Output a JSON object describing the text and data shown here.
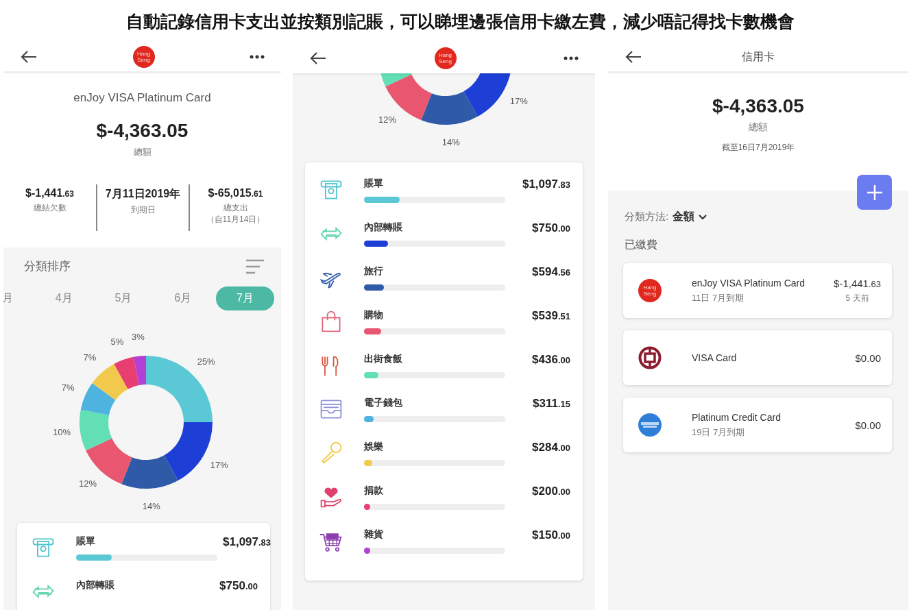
{
  "headline": "自動記錄信用卡支出並按類別記賬，可以睇埋邊張信用卡繳左費，減少唔記得找卡數機會",
  "card_detail": {
    "logo_text": "Hang Seng",
    "card_name": "enJoy VISA Platinum Card",
    "total": "$-4,363.05",
    "total_label": "總額",
    "summary": [
      {
        "amount": "$-1,441",
        "decimals": ".63",
        "label": "總結欠數"
      },
      {
        "amount": "7月11日2019年",
        "label": "到期日"
      },
      {
        "amount": "$-65,015",
        "decimals": ".61",
        "label": "總支出",
        "note": "（自11月14日）"
      }
    ],
    "sort_title": "分類排序",
    "months": [
      {
        "label": "月",
        "selected": false
      },
      {
        "label": "4月",
        "selected": false
      },
      {
        "label": "5月",
        "selected": false
      },
      {
        "label": "6月",
        "selected": false
      },
      {
        "label": "7月",
        "selected": true
      }
    ],
    "chart_data": {
      "type": "donut",
      "values": [
        25,
        17,
        14,
        12,
        10,
        7,
        7,
        5,
        3
      ],
      "colors": [
        "#5bc8d6",
        "#1e3fd6",
        "#2f5aa8",
        "#e8566f",
        "#62dfb5",
        "#4fb3df",
        "#f2c94c",
        "#e83e72",
        "#b23fd6"
      ],
      "value_labels": [
        "25%",
        "17%",
        "14%",
        "12%",
        "10%",
        "7%",
        "7%",
        "5%",
        "3%"
      ]
    },
    "categories": [
      {
        "name": "賬單",
        "amount": "$1,097",
        "decimals": ".83",
        "level": 0.25,
        "color": "#5bc8d6"
      },
      {
        "name": "內部轉賬",
        "amount": "$750",
        "decimals": ".00"
      }
    ]
  },
  "category_breakdown": {
    "logo_text": "Hang Seng",
    "chart_data": {
      "type": "donut",
      "values": [
        17,
        14,
        12,
        10
      ],
      "colors": [
        "#1e3fd6",
        "#2f5aa8",
        "#e8566f",
        "#62dfb5"
      ],
      "value_labels": [
        "17%",
        "14%",
        "12%",
        null
      ]
    },
    "categories": [
      {
        "name": "賬單",
        "amount": "$1,097",
        "decimals": ".83",
        "level": 0.25,
        "color": "#5bc8d6"
      },
      {
        "name": "內部轉賬",
        "amount": "$750",
        "decimals": ".00",
        "level": 0.17,
        "color": "#1e3fd6"
      },
      {
        "name": "旅行",
        "amount": "$594",
        "decimals": ".56",
        "level": 0.14,
        "color": "#2f5aa8"
      },
      {
        "name": "購物",
        "amount": "$539",
        "decimals": ".51",
        "level": 0.12,
        "color": "#e8566f"
      },
      {
        "name": "出街食飯",
        "amount": "$436",
        "decimals": ".00",
        "level": 0.1,
        "color": "#62dfb5"
      },
      {
        "name": "電子錢包",
        "amount": "$311",
        "decimals": ".15",
        "level": 0.07,
        "color": "#4fb3df"
      },
      {
        "name": "娛樂",
        "amount": "$284",
        "decimals": ".00",
        "level": 0.06,
        "color": "#f2c94c"
      },
      {
        "name": "捐款",
        "amount": "$200",
        "decimals": ".00",
        "level": 0.04,
        "color": "#e83e72"
      },
      {
        "name": "雜貨",
        "amount": "$150",
        "decimals": ".00",
        "level": 0.03,
        "color": "#b23fd6"
      }
    ]
  },
  "card_list": {
    "title": "信用卡",
    "total": "$-4,363.05",
    "total_label": "總額",
    "as_of": "截至16日7月2019年",
    "sort_label": "分類方法:",
    "sort_value": "金額",
    "section": "已繳費",
    "cards": [
      {
        "kind": "lettered",
        "logo_text": "Hang Seng",
        "name": "enJoy VISA Platinum Card",
        "due": "11日 7月到期",
        "amount": "$-1,441",
        "decimals": ".63",
        "ago": "5 天前"
      },
      {
        "kind": "ring",
        "name": "VISA Card",
        "amount": "$0.00"
      },
      {
        "kind": "band",
        "name": "Platinum Credit Card",
        "due": "19日 7月到期",
        "amount": "$0.00"
      }
    ]
  }
}
